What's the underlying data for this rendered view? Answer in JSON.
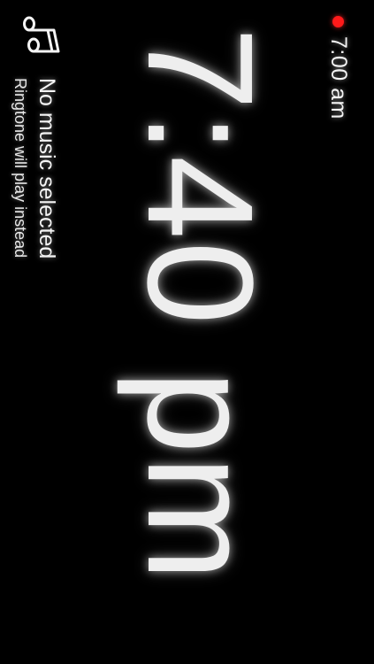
{
  "alarm": {
    "time": "7:00 am",
    "indicator_color": "#ff1a1a"
  },
  "clock": {
    "time": "7:40 pm"
  },
  "music": {
    "icon": "music-note-icon",
    "title": "No music selected",
    "subtitle": "Ringtone will play instead"
  }
}
